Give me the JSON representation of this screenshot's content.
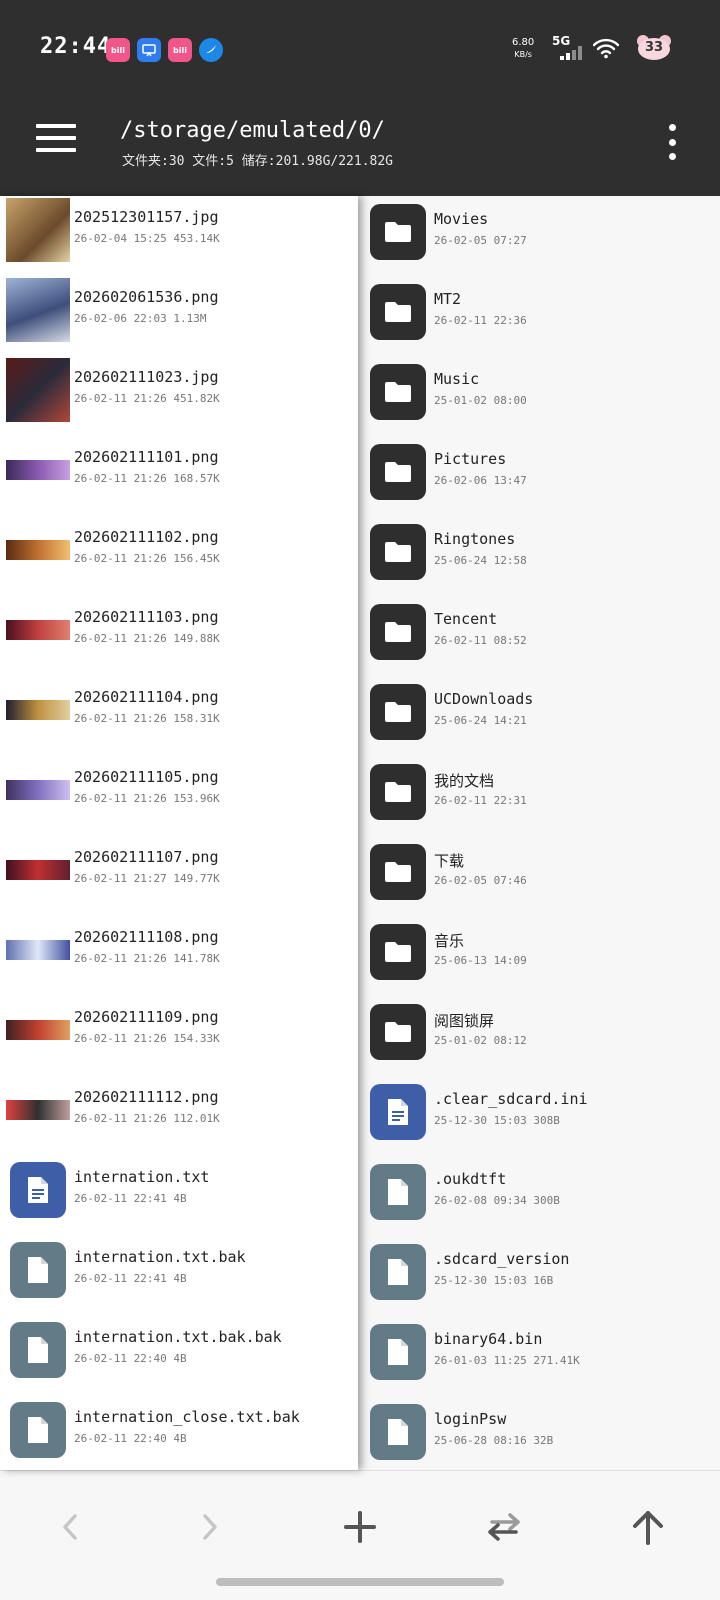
{
  "status_bar": {
    "time": "22:44",
    "speed_value": "6.80",
    "speed_unit": "KB/s",
    "network": "5G",
    "battery_level": "33",
    "notification_icons": [
      "bilibili-icon",
      "screen-recorder-icon",
      "bilibili-icon",
      "browser-icon"
    ]
  },
  "header": {
    "path": "/storage/emulated/0/",
    "summary": "文件夹:30 文件:5 储存:201.98G/221.82G"
  },
  "left_pane": {
    "items": [
      {
        "name": "202512301157.jpg",
        "meta": "26-02-04 15:25  453.14K",
        "kind": "image"
      },
      {
        "name": "202602061536.png",
        "meta": "26-02-06 22:03  1.13M",
        "kind": "image"
      },
      {
        "name": "202602111023.jpg",
        "meta": "26-02-11 21:26  451.82K",
        "kind": "image"
      },
      {
        "name": "202602111101.png",
        "meta": "26-02-11 21:26  168.57K",
        "kind": "banner"
      },
      {
        "name": "202602111102.png",
        "meta": "26-02-11 21:26  156.45K",
        "kind": "banner"
      },
      {
        "name": "202602111103.png",
        "meta": "26-02-11 21:26  149.88K",
        "kind": "banner"
      },
      {
        "name": "202602111104.png",
        "meta": "26-02-11 21:26  158.31K",
        "kind": "banner"
      },
      {
        "name": "202602111105.png",
        "meta": "26-02-11 21:26  153.96K",
        "kind": "banner"
      },
      {
        "name": "202602111107.png",
        "meta": "26-02-11 21:27  149.77K",
        "kind": "banner"
      },
      {
        "name": "202602111108.png",
        "meta": "26-02-11 21:26  141.78K",
        "kind": "banner"
      },
      {
        "name": "202602111109.png",
        "meta": "26-02-11 21:26  154.33K",
        "kind": "banner"
      },
      {
        "name": "202602111112.png",
        "meta": "26-02-11 21:26  112.01K",
        "kind": "banner"
      },
      {
        "name": "internation.txt",
        "meta": "26-02-11 22:41  4B",
        "kind": "doc-blue"
      },
      {
        "name": "internation.txt.bak",
        "meta": "26-02-11 22:41  4B",
        "kind": "doc-gray"
      },
      {
        "name": "internation.txt.bak.bak",
        "meta": "26-02-11 22:40  4B",
        "kind": "doc-gray"
      },
      {
        "name": "internation_close.txt.bak",
        "meta": "26-02-11 22:40  4B",
        "kind": "doc-gray"
      }
    ]
  },
  "right_pane": {
    "items": [
      {
        "name": "Movies",
        "meta": "26-02-05 07:27",
        "kind": "folder"
      },
      {
        "name": "MT2",
        "meta": "26-02-11 22:36",
        "kind": "folder"
      },
      {
        "name": "Music",
        "meta": "25-01-02 08:00",
        "kind": "folder"
      },
      {
        "name": "Pictures",
        "meta": "26-02-06 13:47",
        "kind": "folder"
      },
      {
        "name": "Ringtones",
        "meta": "25-06-24 12:58",
        "kind": "folder"
      },
      {
        "name": "Tencent",
        "meta": "26-02-11 08:52",
        "kind": "folder"
      },
      {
        "name": "UCDownloads",
        "meta": "25-06-24 14:21",
        "kind": "folder"
      },
      {
        "name": "我的文档",
        "meta": "26-02-11 22:31",
        "kind": "folder"
      },
      {
        "name": "下载",
        "meta": "26-02-05 07:46",
        "kind": "folder"
      },
      {
        "name": "音乐",
        "meta": "25-06-13 14:09",
        "kind": "folder"
      },
      {
        "name": "阅图锁屏",
        "meta": "25-01-02 08:12",
        "kind": "folder"
      },
      {
        "name": ".clear_sdcard.ini",
        "meta": "25-12-30 15:03  308B",
        "kind": "doc-blue"
      },
      {
        "name": ".oukdtft",
        "meta": "26-02-08 09:34  300B",
        "kind": "doc-gray"
      },
      {
        "name": ".sdcard_version",
        "meta": "25-12-30 15:03  16B",
        "kind": "doc-gray"
      },
      {
        "name": "binary64.bin",
        "meta": "26-01-03 11:25  271.41K",
        "kind": "doc-gray"
      },
      {
        "name": "loginPsw",
        "meta": "25-06-28 08:16  32B",
        "kind": "doc-gray"
      }
    ]
  },
  "toolbar": {
    "buttons": [
      "back-icon",
      "forward-icon",
      "add-icon",
      "swap-icon",
      "up-icon"
    ]
  },
  "colors": {
    "header_bg": "#2f2f2f",
    "folder_icon_bg": "#2e2e2e",
    "doc_blue": "#3f5ea8",
    "doc_gray": "#637a87"
  }
}
